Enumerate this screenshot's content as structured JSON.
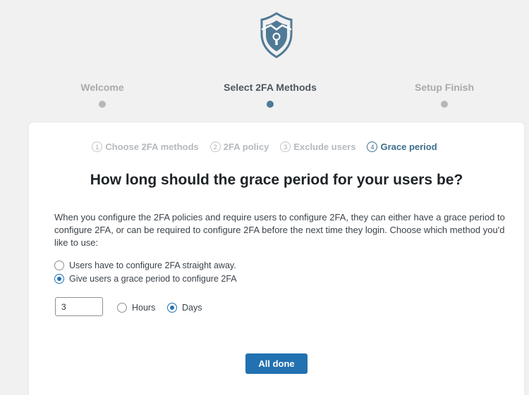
{
  "wizard": {
    "top_steps": [
      {
        "label": "Welcome",
        "active": false
      },
      {
        "label": "Select 2FA Methods",
        "active": true
      },
      {
        "label": "Setup Finish",
        "active": false
      }
    ]
  },
  "card": {
    "sub_steps": [
      {
        "num": "1",
        "label": "Choose 2FA methods",
        "active": false
      },
      {
        "num": "2",
        "label": "2FA policy",
        "active": false
      },
      {
        "num": "3",
        "label": "Exclude users",
        "active": false
      },
      {
        "num": "4",
        "label": "Grace period",
        "active": true
      }
    ],
    "heading": "How long should the grace period for your users be?",
    "description": "When you configure the 2FA policies and require users to configure 2FA, they can either have a grace period to configure 2FA, or can be required to configure 2FA before the next time they login. Choose which method you'd like to use:",
    "options": {
      "immediate": {
        "label": "Users have to configure 2FA straight away.",
        "checked": false
      },
      "grace": {
        "label": "Give users a grace period to configure 2FA",
        "checked": true
      }
    },
    "grace_value": "3",
    "units": {
      "hours": {
        "label": "Hours",
        "checked": false
      },
      "days": {
        "label": "Days",
        "checked": true
      }
    },
    "done_label": "All done"
  },
  "colors": {
    "accent": "#2271b1",
    "step_active": "#4f7a96",
    "logo": "#4f7a96"
  }
}
